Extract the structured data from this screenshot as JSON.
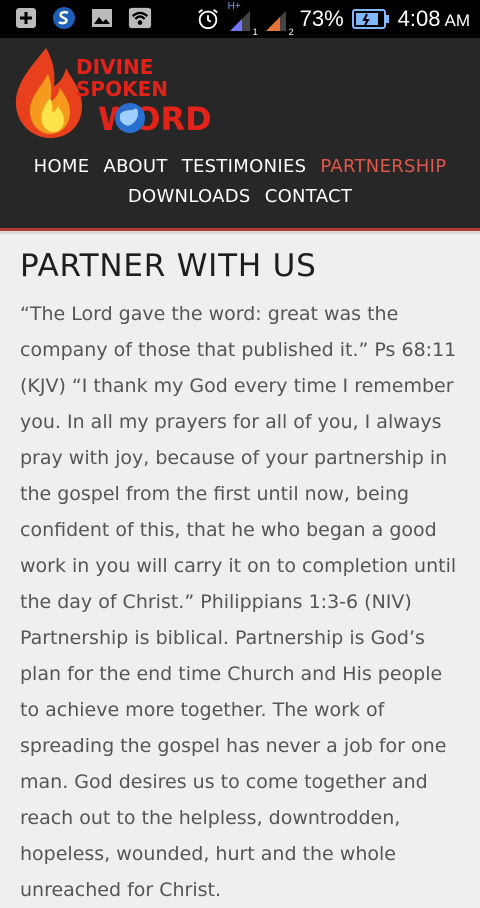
{
  "status_bar": {
    "battery_percent": "73%",
    "time": "4:08",
    "ampm": "AM",
    "network_type": "H+",
    "sim_number": "1",
    "sim2_number": "2",
    "icons": [
      "plus-notification-icon",
      "s-app-icon",
      "image-icon",
      "wifi-icon",
      "alarm-icon",
      "signal-icon",
      "signal-2-icon",
      "battery-icon"
    ]
  },
  "header": {
    "logo_text_line1": "DIVINE",
    "logo_text_line2": "SPOKEN",
    "logo_text_line3": "WORD",
    "nav": [
      {
        "label": "HOME",
        "active": false
      },
      {
        "label": "ABOUT",
        "active": false
      },
      {
        "label": "TESTIMONIES",
        "active": false
      },
      {
        "label": "PARTNERSHIP",
        "active": true
      },
      {
        "label": "DOWNLOADS",
        "active": false
      },
      {
        "label": "CONTACT",
        "active": false
      }
    ]
  },
  "main": {
    "title": "PARTNER WITH US",
    "body": "“The Lord gave the word: great was the company of those that published it.” Ps 68:11 (KJV) “I thank my God every time I remember you. In all my prayers for all of you, I always pray with joy, because of your partnership in the gospel from the first until now, being confident of this, that he who began a good work in you will carry it on to completion until the day of Christ.” Philippians 1:3-6 (NIV) Partnership is biblical. Partnership is God’s plan for the end time Church and His people to achieve more together. The work of spreading the gospel has never a job for one man. God desires us to come together and reach out to the helpless, downtrodden, hopeless, wounded, hurt and the whole unreached for Christ."
  },
  "colors": {
    "header_bg": "#272727",
    "active_nav": "#e0574a",
    "accent_line": "#b33a2e",
    "page_bg": "#efefef"
  }
}
